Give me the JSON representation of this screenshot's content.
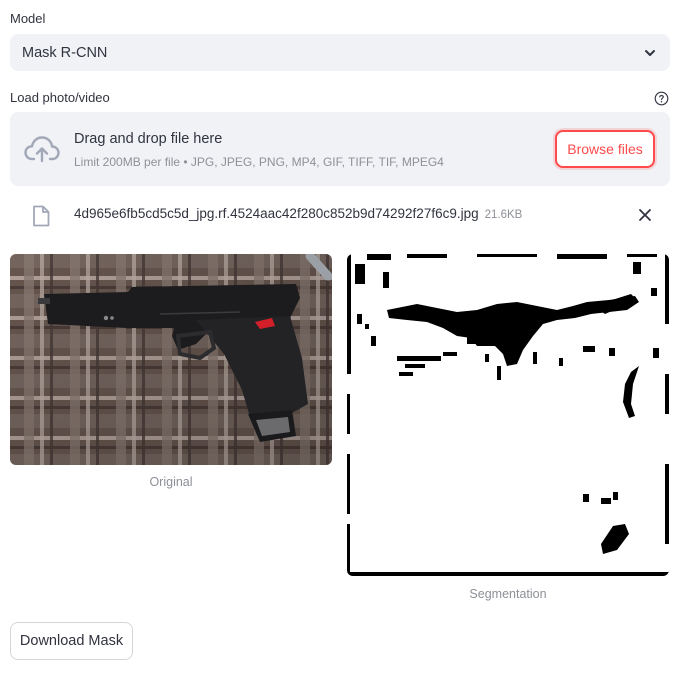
{
  "model": {
    "label": "Model",
    "selected": "Mask R-CNN"
  },
  "upload": {
    "label": "Load photo/video",
    "drop_title": "Drag and drop file here",
    "drop_limits": "Limit 200MB per file • JPG, JPEG, PNG, MP4, GIF, TIFF, TIF, MPEG4",
    "browse_label": "Browse files",
    "file": {
      "name": "4d965e6fb5cd5c5d_jpg.rf.4524aac42f280c852b9d74292f27f6c9.jpg",
      "size": "21.6KB"
    }
  },
  "images": {
    "original_caption": "Original",
    "segmentation_caption": "Segmentation"
  },
  "actions": {
    "download_label": "Download Mask"
  },
  "colors": {
    "accent": "#ff4b4b",
    "widget_bg": "#f0f2f6",
    "text": "#31333f",
    "muted": "#8e9098"
  }
}
